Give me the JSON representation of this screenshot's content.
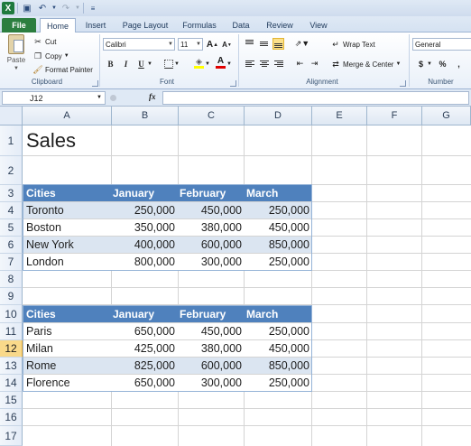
{
  "ribbon": {
    "tabs": [
      {
        "label": "File"
      },
      {
        "label": "Home"
      },
      {
        "label": "Insert"
      },
      {
        "label": "Page Layout"
      },
      {
        "label": "Formulas"
      },
      {
        "label": "Data"
      },
      {
        "label": "Review"
      },
      {
        "label": "View"
      }
    ],
    "clipboard": {
      "paste": "Paste",
      "cut": "Cut",
      "copy": "Copy",
      "format_painter": "Format Painter",
      "label": "Clipboard"
    },
    "font": {
      "name": "Calibri",
      "size": "11",
      "label": "Font",
      "bold": "B",
      "italic": "I",
      "underline": "U"
    },
    "alignment": {
      "wrap_text": "Wrap Text",
      "merge_center": "Merge & Center",
      "label": "Alignment"
    },
    "number": {
      "format": "General",
      "currency": "$",
      "percent": "%",
      "comma": ",",
      "label": "Number"
    }
  },
  "formula_bar": {
    "name_box": "J12",
    "fx": "fx",
    "formula": ""
  },
  "columns": [
    "A",
    "B",
    "C",
    "D",
    "E",
    "F",
    "G"
  ],
  "rows": [
    "1",
    "2",
    "3",
    "4",
    "5",
    "6",
    "7",
    "8",
    "9",
    "10",
    "11",
    "12",
    "13",
    "14",
    "15",
    "16",
    "17"
  ],
  "selected_row": "12",
  "sheet": {
    "title": "Sales",
    "table1": {
      "headers": [
        "Cities",
        "January",
        "February",
        "March"
      ],
      "rows": [
        {
          "city": "Toronto",
          "jan": "250,000",
          "feb": "450,000",
          "mar": "250,000"
        },
        {
          "city": "Boston",
          "jan": "350,000",
          "feb": "380,000",
          "mar": "450,000"
        },
        {
          "city": "New York",
          "jan": "400,000",
          "feb": "600,000",
          "mar": "850,000"
        },
        {
          "city": "London",
          "jan": "800,000",
          "feb": "300,000",
          "mar": "250,000"
        }
      ]
    },
    "table2": {
      "headers": [
        "Cities",
        "January",
        "February",
        "March"
      ],
      "rows": [
        {
          "city": "Paris",
          "jan": "650,000",
          "feb": "450,000",
          "mar": "250,000"
        },
        {
          "city": "Milan",
          "jan": "425,000",
          "feb": "380,000",
          "mar": "450,000"
        },
        {
          "city": "Rome",
          "jan": "825,000",
          "feb": "600,000",
          "mar": "850,000"
        },
        {
          "city": "Florence",
          "jan": "650,000",
          "feb": "300,000",
          "mar": "250,000"
        }
      ]
    }
  },
  "colors": {
    "header_blue": "#4f81bd",
    "band_light": "#dbe5f1",
    "file_tab": "#2c7e3f",
    "selection": "#f9d98a"
  }
}
